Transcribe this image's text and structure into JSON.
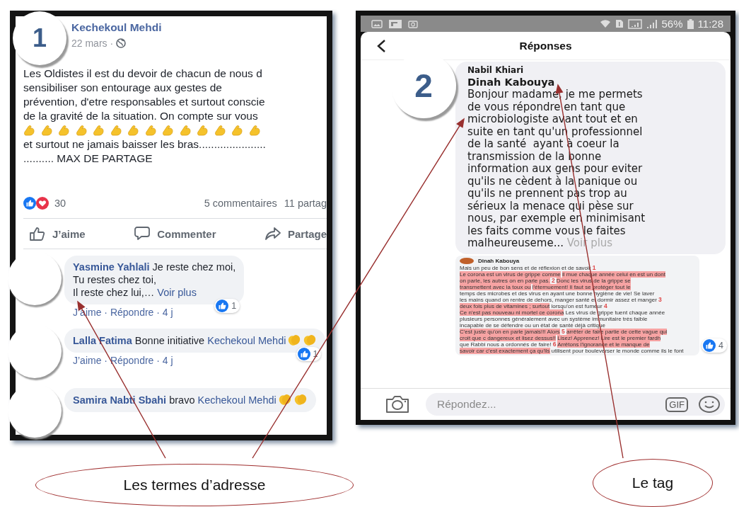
{
  "post_panel": {
    "badge": "1",
    "author": "Kechekoul Mehdi",
    "date": "22 mars ·",
    "text_top": "Les Oldistes il est du devoir de chacun de nous d\nsensibiliser son entourage aux gestes de\nprévention, d'etre responsables et surtout conscie\nde la gravité de la situation. On compte sur vous",
    "emojis": [
      {
        "kind": "flexed-arm"
      },
      {
        "kind": "flexed-arm"
      },
      {
        "kind": "flexed-arm"
      },
      {
        "kind": "flexed-arm"
      },
      {
        "kind": "flexed-arm"
      },
      {
        "kind": "flexed-arm"
      },
      {
        "kind": "flexed-arm"
      },
      {
        "kind": "flexed-arm"
      },
      {
        "kind": "flexed-arm"
      },
      {
        "kind": "flexed-arm"
      },
      {
        "kind": "flexed-arm"
      },
      {
        "kind": "flexed-arm"
      },
      {
        "kind": "flexed-arm"
      },
      {
        "kind": "flexed-arm"
      }
    ],
    "text_bottom": "et surtout ne jamais baisser les bras......................\n.......... MAX DE PARTAGE",
    "reaction_count": "30",
    "comments_count": "5 commentaires",
    "shares_count": "11 partag",
    "actions": [
      {
        "kind": "like",
        "label": "J’aime"
      },
      {
        "kind": "comment",
        "label": "Commenter"
      },
      {
        "kind": "share",
        "label": "Partage"
      }
    ],
    "comments": [
      {
        "segments": [
          {
            "kind": "author",
            "text": "Yasmine Yahlali"
          },
          {
            "kind": "text",
            "text": " Je reste chez moi,\nTu restes chez toi,\nIl reste chez lui,… "
          },
          {
            "kind": "link",
            "text": "Voir plus"
          }
        ],
        "likes": "1",
        "meta": "J’aime · Répondre · 4 j"
      },
      {
        "segments": [
          {
            "kind": "author",
            "text": "Lalla Fatima"
          },
          {
            "kind": "text",
            "text": " Bonne initiative "
          },
          {
            "kind": "mention",
            "text": "Kechekoul Mehdi"
          },
          {
            "kind": "clap"
          },
          {
            "kind": "clap"
          }
        ],
        "likes": "1",
        "meta": "J’aime · Répondre · 4 j"
      },
      {
        "segments": [
          {
            "kind": "author",
            "text": "Samira Nabti Sbahi"
          },
          {
            "kind": "text",
            "text": " bravo "
          },
          {
            "kind": "mention",
            "text": "Kechekoul Mehdi"
          },
          {
            "kind": "clap"
          },
          {
            "kind": "clap"
          }
        ]
      }
    ]
  },
  "reply_panel": {
    "badge": "2",
    "battery": "56%",
    "time": "11:28",
    "title": "Réponses",
    "reply": {
      "author": "Nabil Khiari",
      "tag": "Dinah Kabouya",
      "body": "Bonjour madame, je me permets\nde vous répondre en tant que\nmicrobiologiste avant tout et en\nsuite en tant qu'un professionnel\nde la santé  ayant à coeur la\ntransmission de la bonne\ninformation aux gens pour eviter\nqu'ils ne cèdent à la panique ou\nqu'ils ne prennent pas trop au\nsérieux la menace qui pèse sur\nnous, par exemple en minimisant\nles faits comme vous le faites\nmalheureuseme... ",
      "more": "Voir plus"
    },
    "quoted": {
      "author": "Dinah Kabouya",
      "likes": "4",
      "lines": [
        {
          "text": "Mais un peu de bon sens et de réflexion",
          "highlighted": false
        },
        {
          "text": "et de savoir",
          "highlighted": false
        },
        {
          "text": "Le corona est un virus de grippe comme",
          "highlighted": true,
          "number": "1"
        },
        {
          "text": "il mue chaque année celui en est un dont",
          "highlighted": true
        },
        {
          "text": "on parle, les autres on en parle pas.",
          "highlighted": true
        },
        {
          "text": "Donc les virus de la grippe se",
          "highlighted": true,
          "number": "2"
        },
        {
          "text": "transmettent avec la toux ou",
          "highlighted": true
        },
        {
          "text": "l'éternuement! Il faut se protéger tout le",
          "highlighted": true
        },
        {
          "text": "temps des microbes et des virus en",
          "highlighted": false
        },
        {
          "text": "ayant une bonne hygiène de vie! Se laver",
          "highlighted": false
        },
        {
          "text": "les mains quand on rentre de dehors,",
          "highlighted": false
        },
        {
          "text": "manger santé et dormir assez et manger",
          "highlighted": false
        },
        {
          "text": "deux fois plus de vitamines ; surtout",
          "highlighted": true,
          "number": "3"
        },
        {
          "text": "lorsqu'on est fumeur",
          "highlighted": false
        },
        {
          "text": "Ce n'est pas nouveau ni mortel ce corona",
          "highlighted": true,
          "number": "4"
        },
        {
          "text": "Les virus de grippe tuent chaque année",
          "highlighted": false
        },
        {
          "text": "plusieurs personnes généralement avec",
          "highlighted": false
        },
        {
          "text": "un système immunitaire très faible",
          "highlighted": false
        },
        {
          "text": "incapable de se défendre ou un état de",
          "highlighted": false
        },
        {
          "text": "santé déjà critique",
          "highlighted": false
        },
        {
          "text": "C'est juste qu'on en parle jamais!!! Alors",
          "highlighted": true
        },
        {
          "text": "arrêter de faire partie de cette vague qui",
          "highlighted": true,
          "number": "5"
        },
        {
          "text": "croit que c dangereux et lisez dessus!!",
          "highlighted": true
        },
        {
          "text": "Lisez! Apprenez! Lire est le premier fardh",
          "highlighted": true
        },
        {
          "text": "que Rabbi nous a ordonnés de faire!",
          "highlighted": false
        },
        {
          "text": "Arrêtons l'ignorance et le manque de",
          "highlighted": true,
          "number": "6"
        },
        {
          "text": "savoir car c'est exactement ça qu'ils",
          "highlighted": true
        },
        {
          "text": "utilisent pour bouleverser le monde",
          "highlighted": false
        },
        {
          "text": "comme ils le font",
          "highlighted": false
        }
      ]
    },
    "composer": {
      "placeholder": "Répondez...",
      "gif": "GIF"
    }
  },
  "annotations": [
    {
      "label": "Les termes d’adresse"
    },
    {
      "label": "Le tag"
    }
  ]
}
